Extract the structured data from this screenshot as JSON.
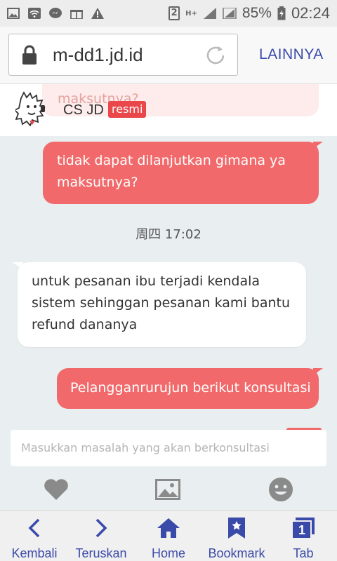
{
  "status_bar": {
    "sim_slot": "2",
    "network_type": "H+",
    "battery_percent": "85%",
    "time": "02:24",
    "icons": [
      "image-icon",
      "wifi-icon",
      "messenger-icon",
      "gift-icon",
      "warning-icon"
    ]
  },
  "browser": {
    "url": "m-dd1.jd.id",
    "more_label": "LAINNYA"
  },
  "chat_header": {
    "agent_name": "CS JD",
    "badge": "resmi",
    "previous_bubble_text": "maksutnya?"
  },
  "messages": [
    {
      "from": "user",
      "lines": [
        "tidak dapat dilanjutkan gimana ya",
        "maksutnya?"
      ]
    },
    {
      "type": "time",
      "text": "周四 17:02"
    },
    {
      "from": "agent",
      "lines": [
        "untuk pesanan ibu terjadi kendala",
        "sistem sehinggan pesanan kami bantu",
        "refund dananya"
      ]
    },
    {
      "from": "user",
      "lines": [
        "Pelangganrurujun berikut konsultasi"
      ]
    }
  ],
  "composer": {
    "placeholder": "Masukkan masalah yang akan berkonsultasi"
  },
  "toolbar": [
    "heart-icon",
    "image-icon",
    "emoji-icon"
  ],
  "bottom_nav": {
    "back": "Kembali",
    "forward": "Teruskan",
    "home": "Home",
    "bookmark": "Bookmark",
    "tab": "Tab",
    "tab_count": "1"
  },
  "colors": {
    "accent": "#f1696a",
    "badge": "#e9474a",
    "nav": "#3a4aa8"
  }
}
